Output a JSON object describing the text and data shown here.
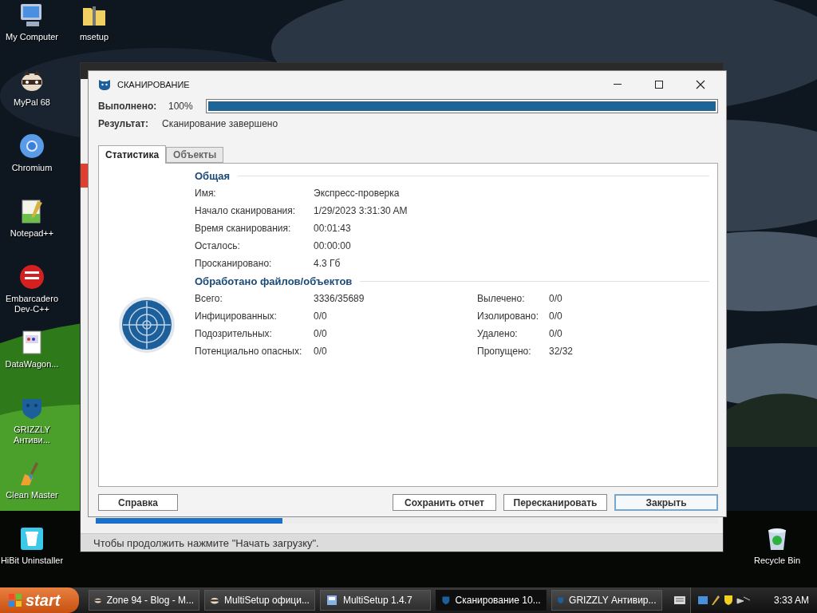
{
  "desktop_icons": [
    {
      "label": "My Computer"
    },
    {
      "label": "msetup"
    },
    {
      "label": "MyPal 68"
    },
    {
      "label": "Chromium"
    },
    {
      "label": "Notepad++"
    },
    {
      "label": "Embarcadero Dev-C++"
    },
    {
      "label": "DataWagon..."
    },
    {
      "label": "GRIZZLY Антиви..."
    },
    {
      "label": "Clean Master"
    },
    {
      "label": "HiBit Uninstaller"
    },
    {
      "label": "Recycle Bin"
    }
  ],
  "background_window": {
    "progress": {
      "level": 0.3
    },
    "status_text": "Чтобы продолжить нажмите \"Начать загрузку\"."
  },
  "dialog": {
    "title": "СКАНИРОВАНИЕ",
    "progress": {
      "label": "Выполнено:",
      "value": "100%",
      "level": 1
    },
    "result": {
      "label": "Результат:",
      "value": "Сканирование завершено"
    },
    "tabs": [
      {
        "label": "Статистика",
        "selected": true
      },
      {
        "label": "Объекты",
        "selected": false
      }
    ],
    "sections": [
      {
        "heading": "Общая",
        "columns": [
          [
            {
              "label": "Имя:",
              "value": "Экспресс-проверка"
            },
            {
              "label": "Начало сканирования:",
              "value": "1/29/2023 3:31:30 AM"
            },
            {
              "label": "Время сканирования:",
              "value": "00:01:43"
            },
            {
              "label": "Осталось:",
              "value": "00:00:00"
            },
            {
              "label": "Просканировано:",
              "value": "4.3 Гб"
            }
          ]
        ]
      },
      {
        "heading": "Обработано файлов/объектов",
        "columns": [
          [
            {
              "label": "Всего:",
              "value": "3336/35689"
            },
            {
              "label": "Инфицированных:",
              "value": "0/0"
            },
            {
              "label": "Подозрительных:",
              "value": "0/0"
            },
            {
              "label": "Потенциально опасных:",
              "value": "0/0"
            }
          ],
          [
            {
              "label": "Вылечено:",
              "value": "0/0"
            },
            {
              "label": "Изолировано:",
              "value": "0/0"
            },
            {
              "label": "Удалено:",
              "value": "0/0"
            },
            {
              "label": "Пропущено:",
              "value": "32/32"
            }
          ]
        ]
      }
    ],
    "buttons": [
      {
        "label": "Справка",
        "focused": false
      },
      {
        "label": "Сохранить отчет",
        "focused": false
      },
      {
        "label": "Пересканировать",
        "focused": false
      },
      {
        "label": "Закрыть",
        "focused": true
      }
    ]
  },
  "taskbar": {
    "start": "start",
    "tasks": [
      {
        "label": "Zone 94 - Blog - M...",
        "selected": false
      },
      {
        "label": "MultiSetup офици...",
        "selected": false
      },
      {
        "label": "MultiSetup 1.4.7",
        "selected": false
      },
      {
        "label": "Сканирование 10...",
        "selected": true
      },
      {
        "label": "GRIZZLY Антивир...",
        "selected": false
      }
    ],
    "clock": "3:33 AM"
  }
}
